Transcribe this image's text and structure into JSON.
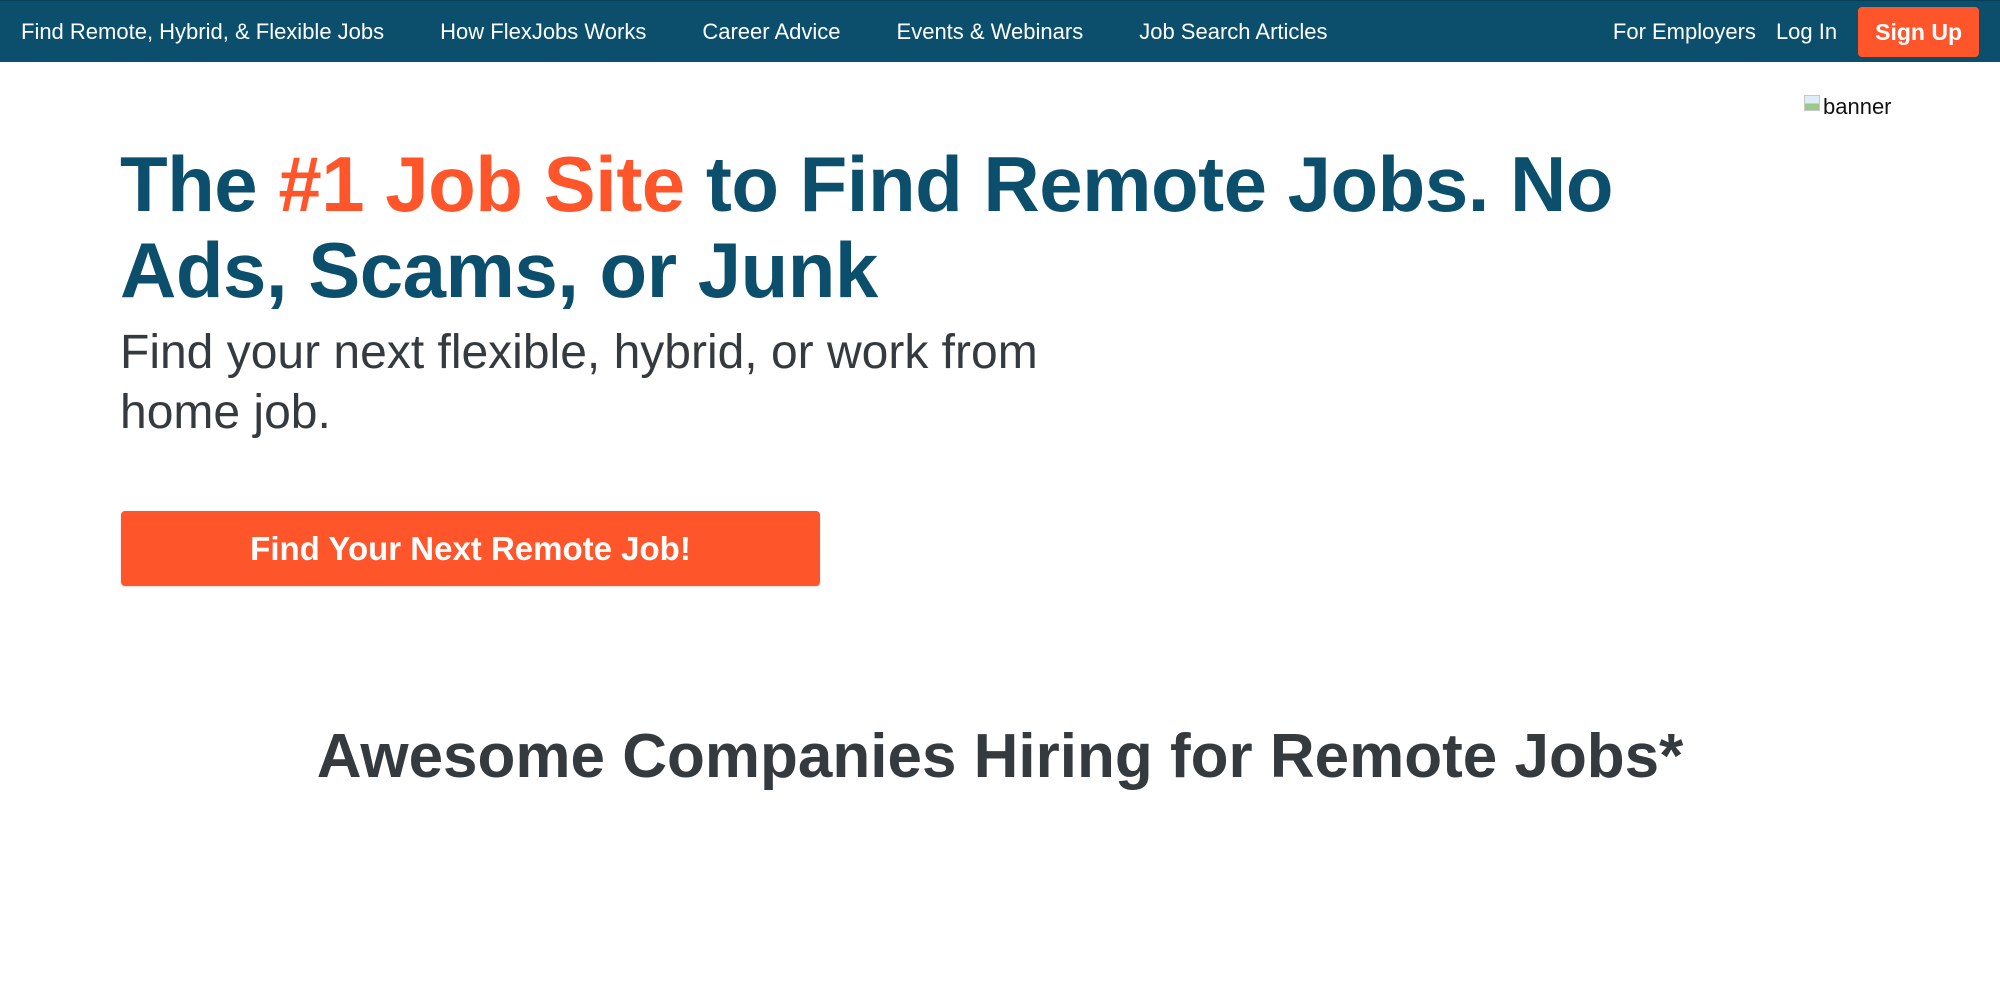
{
  "colors": {
    "nav_bg": "#0b4f6c",
    "accent": "#ff552b",
    "heading": "#0b4f6c",
    "body_text": "#353a3f"
  },
  "nav": {
    "links": [
      "Find Remote, Hybrid, & Flexible Jobs",
      "How FlexJobs Works",
      "Career Advice",
      "Events & Webinars",
      "Job Search Articles"
    ],
    "for_employers": "For Employers",
    "login": "Log In",
    "signup": "Sign Up"
  },
  "banner": {
    "alt_text": "banner",
    "icon": "broken-image-icon"
  },
  "hero": {
    "title_before": "The ",
    "title_accent": "#1 Job Site",
    "title_after": " to Find Remote Jobs. No Ads, Scams, or Junk",
    "subtitle": "Find your next flexible, hybrid, or work from home job.",
    "cta": "Find Your Next Remote Job!"
  },
  "companies": {
    "heading": "Awesome Companies Hiring for Remote Jobs*"
  }
}
